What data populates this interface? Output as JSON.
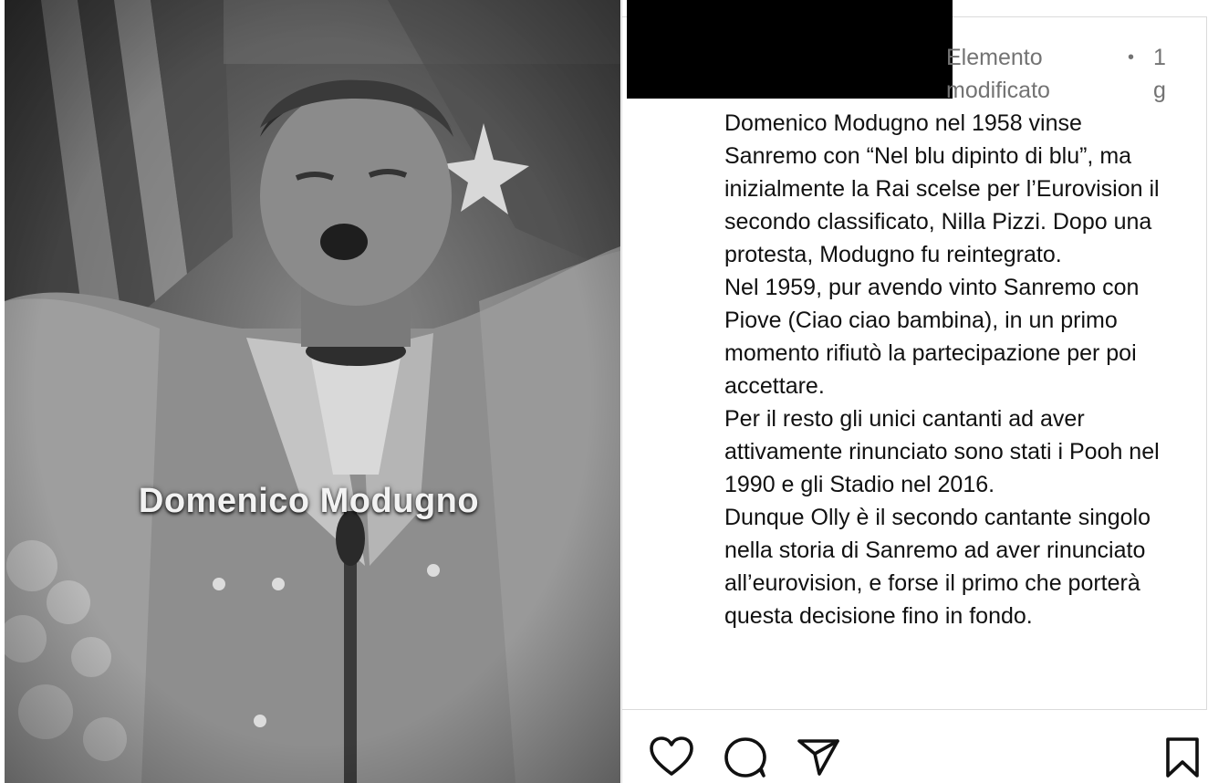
{
  "media": {
    "caption": "Domenico Modugno",
    "colors": {
      "dark": "#2c2c2c",
      "mid": "#6e6e6e",
      "light": "#cfcfcf"
    }
  },
  "comment": {
    "status": {
      "edited_label": "Elemento modificato",
      "separator": "•",
      "time_ago": "1 g"
    },
    "paragraphs": [
      "Domenico Modugno nel 1958 vinse Sanremo con “Nel blu dipinto di blu”, ma inizialmente la Rai scelse per l’Eurovision il secondo classificato, Nilla Pizzi. Dopo una protesta, Modugno fu reintegrato.",
      "Nel 1959, pur avendo vinto Sanremo con Piove (Ciao ciao bambina), in un primo momento rifiutò la partecipazione per poi accettare.",
      "Per il resto gli unici cantanti ad aver attivamente rinunciato sono stati i Pooh nel 1990 e gli Stadio nel 2016.",
      "Dunque Olly è il secondo cantante singolo nella storia di Sanremo ad aver rinunciato all’eurovision, e forse il primo che porterà questa decisione fino in fondo."
    ]
  },
  "actions": {
    "like_icon": "heart-icon",
    "comment_icon": "speech-bubble-icon",
    "share_icon": "paper-plane-icon",
    "save_icon": "bookmark-icon",
    "icon_color": "#111111"
  }
}
